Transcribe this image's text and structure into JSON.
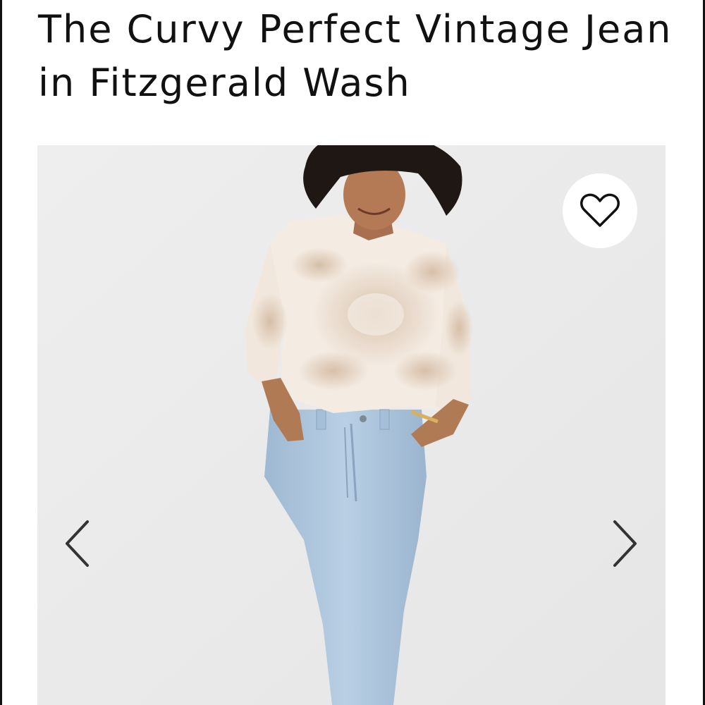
{
  "product": {
    "title": "The Curvy Perfect Vintage Jean in Fitzgerald Wash"
  },
  "gallery": {
    "image_alt": "Model wearing tie-dye sweatshirt and light wash jeans",
    "wishlist_icon": "heart-outline-icon",
    "prev_icon": "chevron-left-icon",
    "next_icon": "chevron-right-icon"
  },
  "colors": {
    "text": "#111111",
    "background": "#ffffff",
    "photo_background": "#ececec",
    "denim": "#a9c3dc",
    "sweatshirt": "#f4ebe2",
    "tie_dye": "#dcc7b3"
  }
}
